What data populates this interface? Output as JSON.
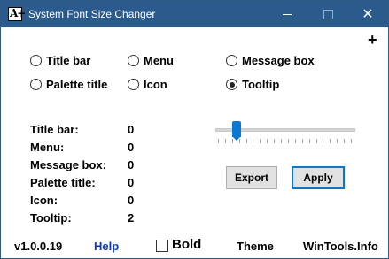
{
  "window": {
    "title": "System Font Size Changer",
    "app_icon_glyph": "A+",
    "close_glyph": "✕"
  },
  "plus_label": "+",
  "options": [
    {
      "label": "Title bar",
      "checked": false
    },
    {
      "label": "Menu",
      "checked": false
    },
    {
      "label": "Message box",
      "checked": false
    },
    {
      "label": "Palette title",
      "checked": false
    },
    {
      "label": "Icon",
      "checked": false
    },
    {
      "label": "Tooltip",
      "checked": true
    }
  ],
  "values": [
    {
      "label": "Title bar:",
      "value": "0"
    },
    {
      "label": "Menu:",
      "value": "0"
    },
    {
      "label": "Message box:",
      "value": "0"
    },
    {
      "label": "Palette title:",
      "value": "0"
    },
    {
      "label": "Icon:",
      "value": "0"
    },
    {
      "label": "Tooltip:",
      "value": "2"
    }
  ],
  "slider": {
    "value_fraction": 0.13,
    "tick_count": 20
  },
  "buttons": {
    "export": "Export",
    "apply": "Apply"
  },
  "footer": {
    "version": "v1.0.0.19",
    "help": "Help",
    "bold": "Bold",
    "theme": "Theme",
    "site": "WinTools.Info"
  },
  "colors": {
    "titlebar": "#2b5b8c",
    "accent": "#0078d7",
    "link": "#0b37c8"
  }
}
